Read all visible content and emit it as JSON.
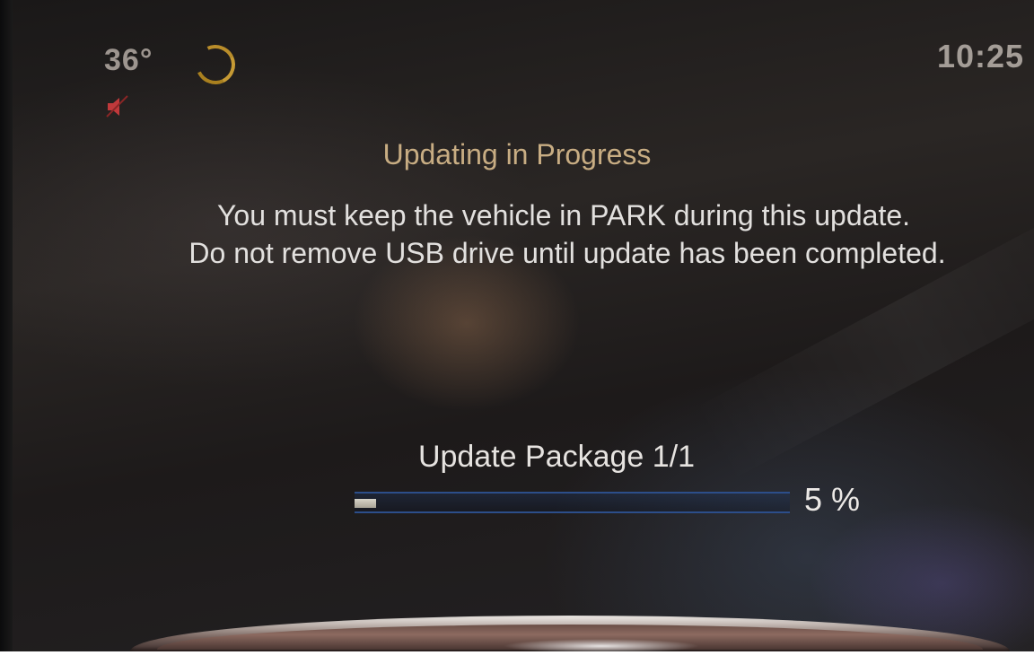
{
  "status_bar": {
    "temperature": "36°",
    "time": "10:25",
    "icons": [
      "loading-spinner-icon",
      "mute-icon"
    ]
  },
  "dialog": {
    "title": "Updating in Progress",
    "message_line1": "You must keep the vehicle in PARK during this update.",
    "message_line2": "Do not remove USB drive until update has been completed."
  },
  "progress": {
    "package_label": "Update Package 1/1",
    "percent_label": "5 %",
    "percent": 5
  },
  "colors": {
    "title": "#c8ad83",
    "spinner": "#b98d2a",
    "mute": "#c0393b",
    "progress_track": "#2c4e8a"
  }
}
